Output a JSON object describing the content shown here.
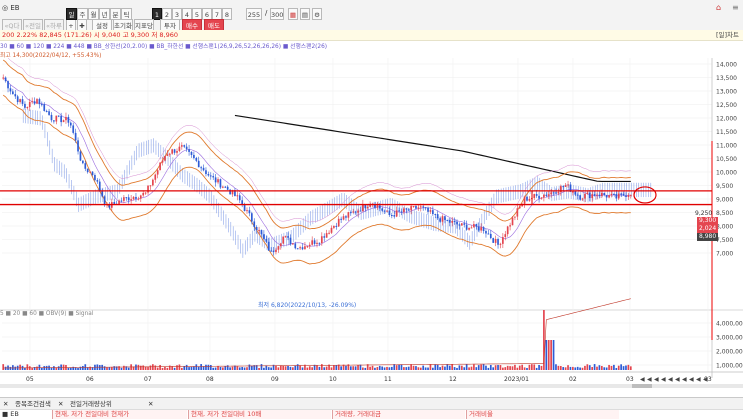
{
  "toolbar": {
    "stock_name": "◎ EB",
    "stepper_value": "255",
    "slash": "/",
    "total_value": "300",
    "period_buttons": [
      "일",
      "주",
      "월",
      "년",
      "분",
      "틱"
    ],
    "number_buttons": [
      "1",
      "2",
      "3",
      "4",
      "5",
      "6",
      "7",
      "8"
    ],
    "row2_left": [
      "«Q다",
      "«전일",
      "«하루"
    ],
    "row2_btns": [
      "설정",
      "초기화",
      "지표당"
    ],
    "row2_right": [
      "투자",
      "매수",
      "매도"
    ]
  },
  "infobar": {
    "text": "200  2.22%  82,845 (171.26)  시 9,040  고 9,300  저 8,960",
    "right": "[일]차트"
  },
  "ma_legend": "30 ■ 60 ■ 120 ■ 224 ■ 448  ■ BB_상한선(20,2.00)  ■ BB_하한선  ■ 선행스팬1(26,9,26,52,26,26,26)  ■ 선행스팬2(26)",
  "max_label": "최고 14,300(2022/04/12, +55.43%)",
  "min_label": "최저 6,820(2022/10/13, -26.09%)",
  "current_price": "9,250",
  "price_box_1": "9,300",
  "price_box_2": "2,024",
  "price_box_3": "8,980",
  "y_axis_labels": [
    "14,000",
    "13,500",
    "13,000",
    "12,500",
    "12,000",
    "11,500",
    "11,000",
    "10,500",
    "10,000",
    "9,500",
    "9,000",
    "8,500",
    "8,000",
    "7,500",
    "7,000"
  ],
  "vol_axis_labels": [
    "4,000,000",
    "3,000,000",
    "2,000,000",
    "1,000,000"
  ],
  "vol_legend": "5  ■ 20  ■ 60  ■ OBV(9)  ■ Signal",
  "x_axis_labels": [
    "05",
    "06",
    "07",
    "08",
    "09",
    "10",
    "11",
    "12",
    "2023/01",
    "02",
    "03",
    "03"
  ],
  "bottom_tabs": [
    "종목조건검색",
    "전일거래량상위"
  ],
  "bottom_strip": [
    "■ EB",
    "현재, 저가 전일대비 현재가",
    "현재, 저가 전일대비 10배",
    "거래량, 거래대금",
    "거래비율"
  ],
  "colors": {
    "up": "#e4454f",
    "down": "#2d5bd6",
    "ma200": "#111111",
    "bb": "#e07a2e",
    "cloud": "#2d5bd6",
    "hline": "#e00000"
  },
  "chart_data": {
    "type": "candlestick",
    "x_labels": [
      "05",
      "06",
      "07",
      "08",
      "09",
      "10",
      "11",
      "12",
      "2023/01",
      "02",
      "03"
    ],
    "y_range": [
      6800,
      14300
    ],
    "high": 14300,
    "low": 6820,
    "last": 9250,
    "resistance_lines": [
      9300,
      8980
    ]
  }
}
